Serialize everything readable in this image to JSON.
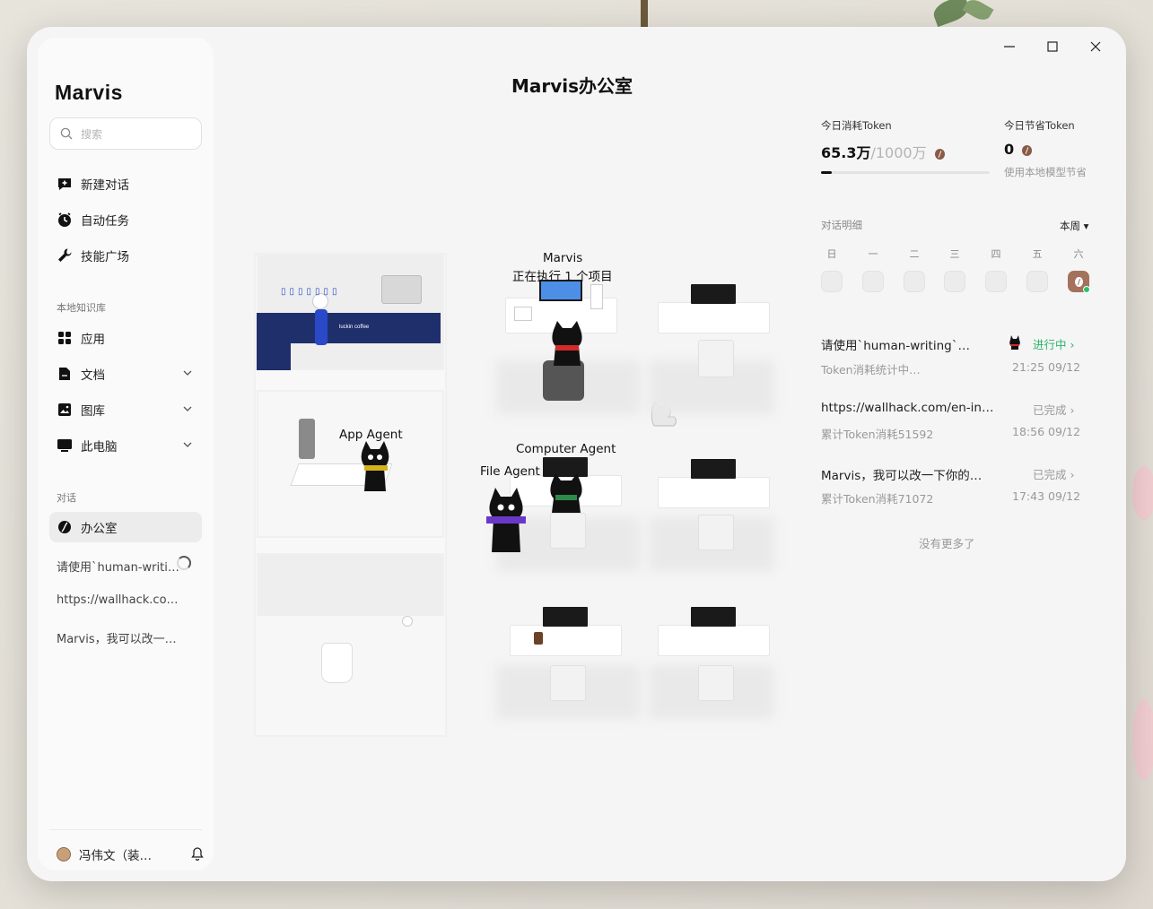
{
  "app": {
    "brand": "Marvis",
    "window_title": "Marvis办公室"
  },
  "search": {
    "placeholder": "搜索"
  },
  "nav": [
    {
      "label": "新建对话",
      "icon": "new-chat-icon"
    },
    {
      "label": "自动任务",
      "icon": "clock-icon"
    },
    {
      "label": "技能广场",
      "icon": "wrench-icon"
    }
  ],
  "knowledge": {
    "section_label": "本地知识库",
    "items": [
      {
        "label": "应用",
        "icon": "apps-grid-icon"
      },
      {
        "label": "文档",
        "icon": "document-icon"
      },
      {
        "label": "图库",
        "icon": "gallery-icon"
      },
      {
        "label": "此电脑",
        "icon": "computer-icon"
      }
    ]
  },
  "conversations": {
    "section_label": "对话",
    "active": "办公室",
    "items": [
      "请使用`human-writing…",
      "https://wallhack.com/en-in…",
      "Marvis，我可以改一下你的…"
    ]
  },
  "user": {
    "name": "冯伟文（装修中）"
  },
  "scene": {
    "marvis_label": "Marvis",
    "marvis_status": "正在执行 1 个项目",
    "app_agent": "App Agent",
    "computer_agent": "Computer Agent",
    "file_agent": "File Agent",
    "coffee_brand": "luckin coffee"
  },
  "tokens": {
    "today_used_label": "今日消耗Token",
    "today_used": "65.3万",
    "today_limit": "/1000万",
    "usage_fraction": 0.065,
    "today_saved_label": "今日节省Token",
    "today_saved": "0",
    "saved_note": "使用本地模型节省"
  },
  "details": {
    "label": "对话明细",
    "filter": "本周 ▾",
    "weekdays": [
      "日",
      "一",
      "二",
      "三",
      "四",
      "五",
      "六"
    ],
    "active_day_index": 6
  },
  "conversation_list": [
    {
      "title": "请使用`human-writing`…",
      "sub": "Token消耗统计中…",
      "status": "进行中 ›",
      "time": "21:25 09/12",
      "running": true
    },
    {
      "title": "https://wallhack.com/en-in…",
      "sub": "累计Token消耗51592",
      "status": "已完成 ›",
      "time": "18:56 09/12",
      "running": false
    },
    {
      "title": "Marvis，我可以改一下你的…",
      "sub": "累计Token消耗71072",
      "status": "已完成 ›",
      "time": "17:43 09/12",
      "running": false
    }
  ],
  "no_more": "没有更多了",
  "colors": {
    "running_green": "#27b36a",
    "coffee_brown": "#8a5a44",
    "luckin_blue": "#1f2f6b"
  }
}
